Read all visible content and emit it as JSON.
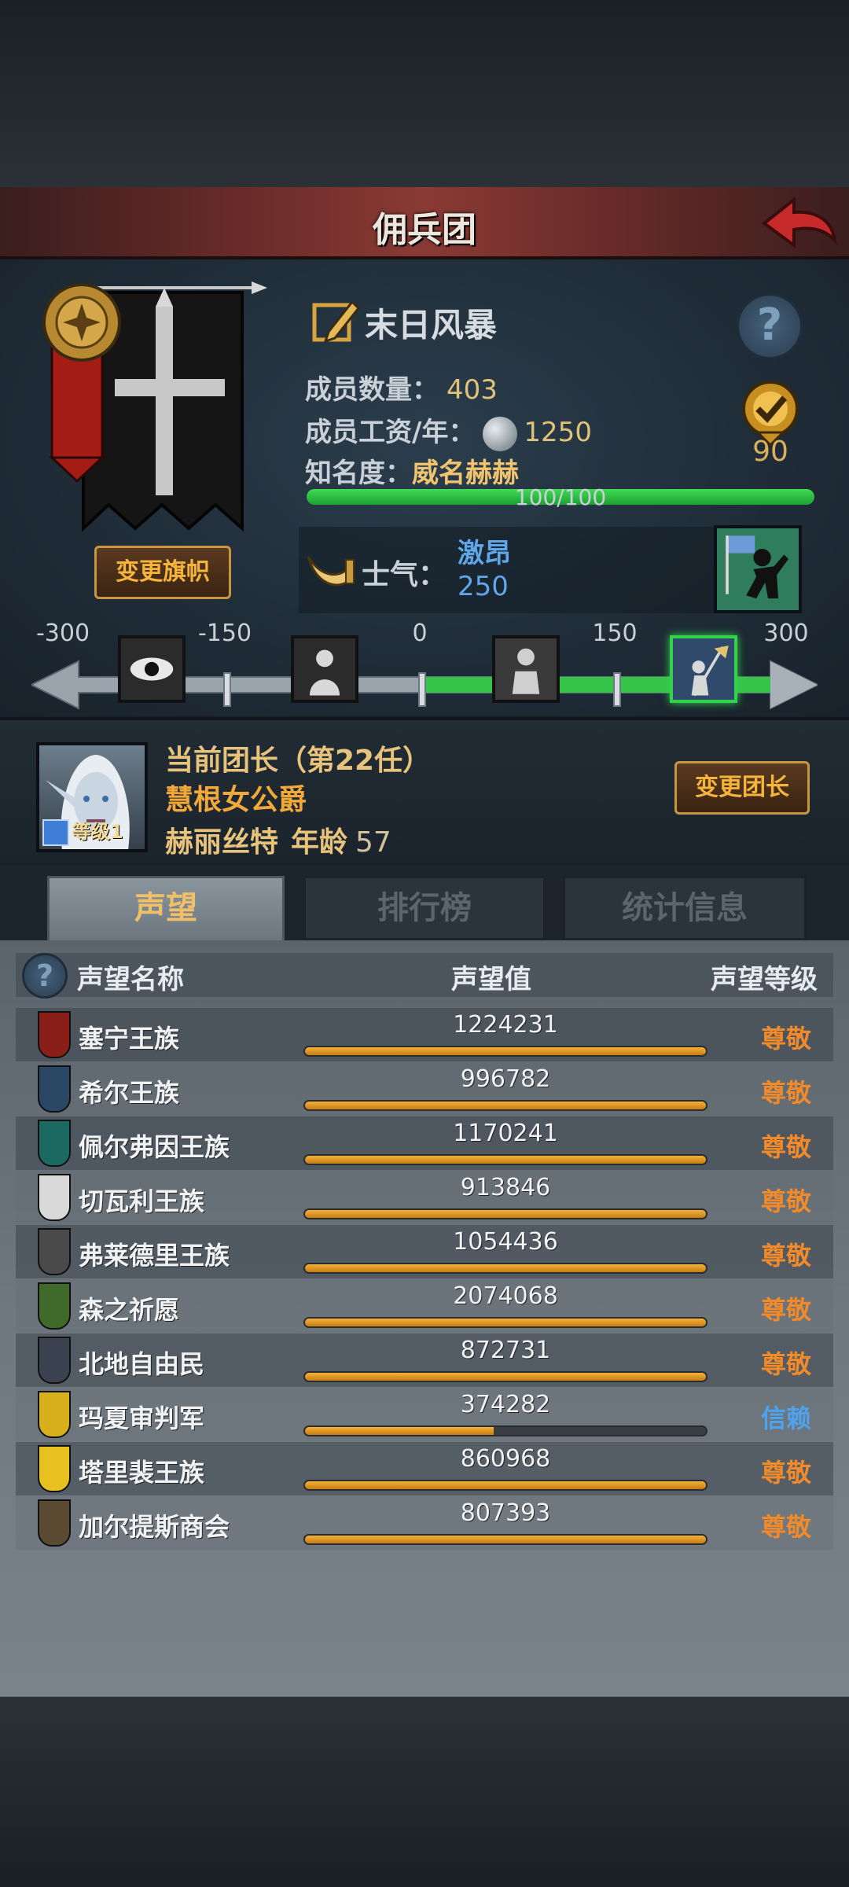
{
  "header": {
    "title": "佣兵团"
  },
  "guild": {
    "name": "末日风暴",
    "member_label": "成员数量：",
    "member_count": "403",
    "salary_label": "成员工资/年：",
    "salary_value": "1250",
    "fame_label": "知名度：",
    "fame_value": "威名赫赫",
    "fame_progress": "100/100",
    "fame_fraction": 1.0,
    "badge_value": "90",
    "change_banner_label": "变更旗帜",
    "help_symbol": "?"
  },
  "morale": {
    "label": "士气：",
    "state": "激昂",
    "value": "250",
    "scale": [
      "-300",
      "-150",
      "0",
      "150",
      "300"
    ],
    "stage_icons": [
      "eye-icon",
      "cowering-figure-icon",
      "sitting-figure-icon",
      "cheering-figure-icon"
    ],
    "active_stage": 3
  },
  "leader": {
    "title": "当前团长（第22任）",
    "rank": "慧根女公爵",
    "name": "赫丽丝特",
    "age_label": "年龄",
    "age": "57",
    "level_label": "等级1",
    "change_label": "变更团长"
  },
  "tabs": [
    {
      "label": "声望"
    },
    {
      "label": "排行榜"
    },
    {
      "label": "统计信息"
    }
  ],
  "reputation": {
    "col_name": "声望名称",
    "col_value": "声望值",
    "col_level": "声望等级",
    "rows": [
      {
        "name": "塞宁王族",
        "value": "1224231",
        "level": "尊敬",
        "fill": 1.0,
        "crest_color": "#8a1f1a",
        "level_color": "#f08a2a"
      },
      {
        "name": "希尔王族",
        "value": "996782",
        "level": "尊敬",
        "fill": 1.0,
        "crest_color": "#2a4866",
        "level_color": "#f08a2a"
      },
      {
        "name": "佩尔弗因王族",
        "value": "1170241",
        "level": "尊敬",
        "fill": 1.0,
        "crest_color": "#1a6a62",
        "level_color": "#f08a2a"
      },
      {
        "name": "切瓦利王族",
        "value": "913846",
        "level": "尊敬",
        "fill": 1.0,
        "crest_color": "#d9d9d9",
        "level_color": "#f08a2a"
      },
      {
        "name": "弗莱德里王族",
        "value": "1054436",
        "level": "尊敬",
        "fill": 1.0,
        "crest_color": "#4a4a4a",
        "level_color": "#f08a2a"
      },
      {
        "name": "森之祈愿",
        "value": "2074068",
        "level": "尊敬",
        "fill": 1.0,
        "crest_color": "#3f6a2a",
        "level_color": "#f08a2a"
      },
      {
        "name": "北地自由民",
        "value": "872731",
        "level": "尊敬",
        "fill": 1.0,
        "crest_color": "#3a4250",
        "level_color": "#f08a2a"
      },
      {
        "name": "玛夏审判军",
        "value": "374282",
        "level": "信赖",
        "fill": 0.47,
        "crest_color": "#d8b01c",
        "level_color": "#4fa3ee"
      },
      {
        "name": "塔里裴王族",
        "value": "860968",
        "level": "尊敬",
        "fill": 1.0,
        "crest_color": "#e8c020",
        "level_color": "#f08a2a"
      },
      {
        "name": "加尔提斯商会",
        "value": "807393",
        "level": "尊敬",
        "fill": 1.0,
        "crest_color": "#5a4a32",
        "level_color": "#f08a2a"
      }
    ]
  },
  "colors": {
    "accent_orange": "#f6b43a",
    "morale_blue": "#5fa7e8",
    "fame_green": "#2fbf44"
  }
}
